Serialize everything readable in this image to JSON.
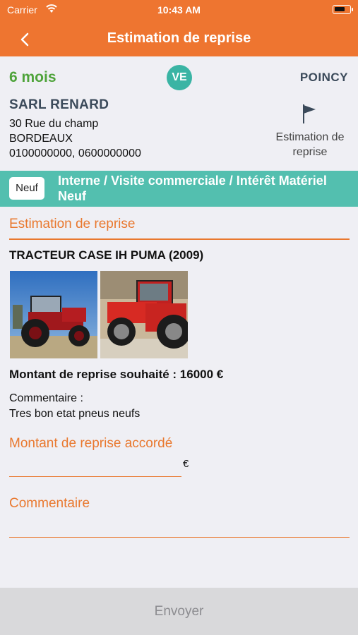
{
  "status_bar": {
    "carrier": "Carrier",
    "time": "10:43 AM"
  },
  "nav": {
    "title": "Estimation de reprise",
    "back_icon": "chevron-left-icon"
  },
  "header": {
    "duration": "6 mois",
    "badge": "VE",
    "location": "POINCY",
    "company": "SARL RENARD",
    "address_line1": "30 Rue du champ",
    "address_line2": "BORDEAUX",
    "phones": "0100000000, 0600000000",
    "flag_icon": "flag-icon",
    "flag_label": "Estimation de reprise"
  },
  "banner": {
    "chip": "Neuf",
    "text": "Interne / Visite commerciale / Intérêt Matériel Neuf"
  },
  "form": {
    "section_title": "Estimation de reprise",
    "machine": "TRACTEUR CASE IH PUMA (2009)",
    "amount_wanted": "Montant de reprise souhaité : 16000 €",
    "comment_label": "Commentaire :",
    "comment_text": "Tres bon etat pneus neufs",
    "granted_label": "Montant de reprise accordé",
    "granted_value": "",
    "currency": "€",
    "comment_field_label": "Commentaire",
    "comment_field_value": ""
  },
  "footer": {
    "send_label": "Envoyer"
  },
  "colors": {
    "accent": "#ee7530",
    "teal": "#53bfaf",
    "green": "#4ea33a"
  }
}
